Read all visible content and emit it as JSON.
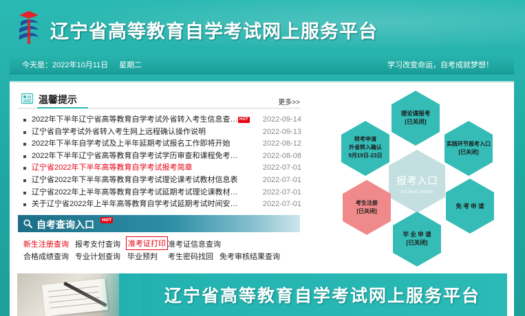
{
  "header": {
    "title": "辽宁省高等教育自学考试网上服务平台",
    "logo_icon": "exam-logo-icon"
  },
  "datebar": {
    "today_label": "今天是：",
    "date": "2022年10月11日",
    "weekday": "星期二",
    "slogan": "学习改变命运，自考成就梦想！"
  },
  "notice": {
    "title": "温馨提示",
    "more": "更多>>",
    "items": [
      {
        "title": "2022年下半年辽宁省高等教育自学考试外省转入考生信息查询...",
        "date": "2022-09-14",
        "hot": "HOT",
        "red": false
      },
      {
        "title": "辽宁省自学考试外省转入考生网上远程确认操作说明",
        "date": "2022-09-13",
        "red": false
      },
      {
        "title": "2022年下半年自学考试及上半年延期考试报名工作即将开始",
        "date": "2022-08-12",
        "red": false
      },
      {
        "title": "2022年下半年辽宁省高等教育自学考试学历审查和课程免考须知",
        "date": "2022-08-08",
        "red": false
      },
      {
        "title": "辽宁省2022年下半年高等教育自学考试报考简章",
        "date": "2022-07-01",
        "red": true
      },
      {
        "title": "辽宁省2022年下半年高等教育自学考试理论课考试教材信息表",
        "date": "2022-07-01",
        "red": false
      },
      {
        "title": "辽宁省2022年上半年高等教育自学考试延期考试理论课教材信...",
        "date": "2022-07-01",
        "red": false
      },
      {
        "title": "关于辽宁省2022年上半年高等教育自学考试延期考试时间安排...",
        "date": "2022-07-01",
        "red": false
      }
    ]
  },
  "query": {
    "title": "自考查询入口",
    "hot": "HOT",
    "row1": [
      "新生注册查询",
      "报考支付查询",
      "准考证打印",
      "准考证信息查询"
    ],
    "row2": [
      "合格成绩查询",
      "专业计划查询",
      "毕业预判",
      "考生密码找回",
      "免考审核结果查询"
    ]
  },
  "hexagons": {
    "center_title": "报考入口",
    "center_sub": "STUDENT SIGNIN",
    "theory": {
      "line1": "理论课报考",
      "line2": "[已关闭]"
    },
    "practice": {
      "line1": "实践环节报考入口",
      "line2": "[已关闭]"
    },
    "transfer": {
      "line1": "转考申请",
      "line2": "外省转入确认",
      "line3": "9月19日-23日"
    },
    "register": {
      "line1": "考生注册",
      "line2": "[已关闭]"
    },
    "exempt": {
      "line1": "免 考 申 请"
    },
    "graduate": {
      "line1": "毕 业 申 请",
      "line2": "[已关闭]"
    }
  },
  "banner": {
    "title": "辽宁省高等教育自学考试网上服务平台"
  },
  "colors": {
    "teal": "#2bb9b3",
    "hex_teal": "#35bcb6",
    "hex_pink": "#f08a8a",
    "hex_center": "#c3dfe0",
    "red": "#e60012"
  }
}
